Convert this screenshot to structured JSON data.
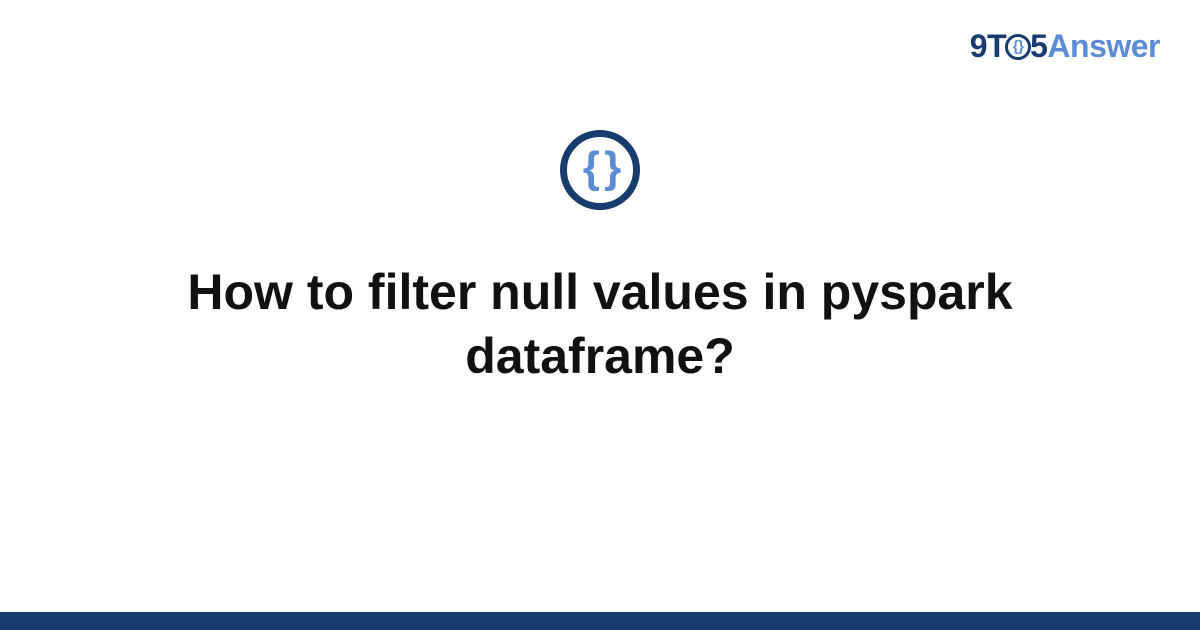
{
  "logo": {
    "part_9t": "9T",
    "part_o_inner": "{}",
    "part_5": "5",
    "part_answer": "Answer"
  },
  "center_icon": {
    "glyph": "{ }"
  },
  "title": "How to filter null values in pyspark dataframe?",
  "colors": {
    "dark_blue": "#183c6e",
    "light_blue": "#5b8dd4"
  }
}
